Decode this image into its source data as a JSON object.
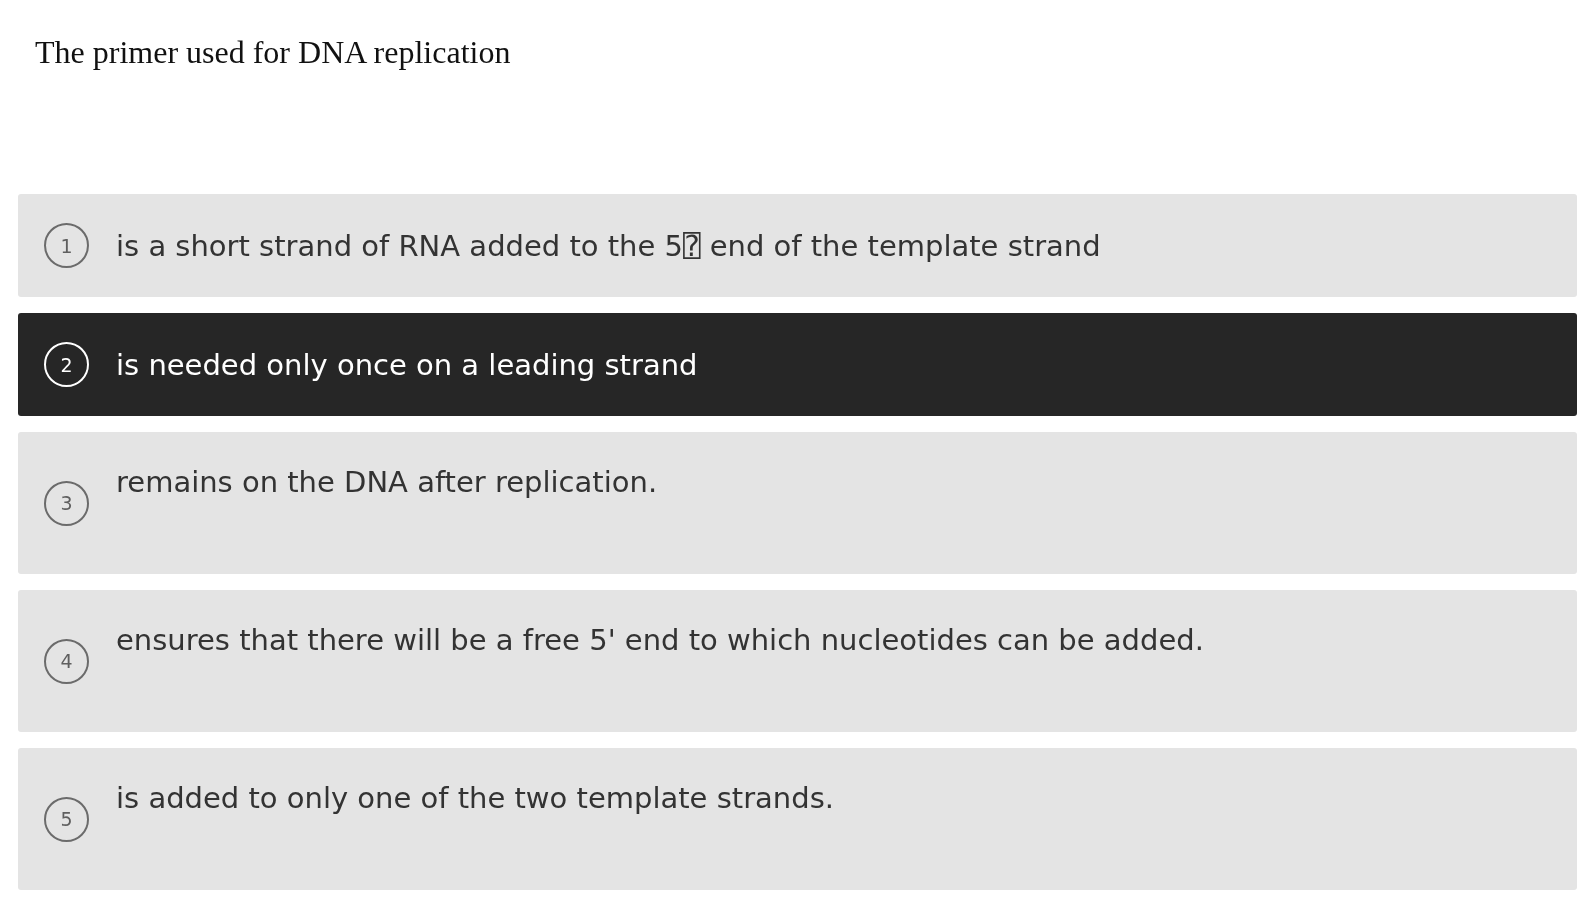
{
  "question": {
    "text": "The primer used for DNA replication"
  },
  "options": [
    {
      "number": "1",
      "text": "is a short strand of RNA added to the 5⍰ end of the template strand",
      "kind": "compact",
      "selected": false
    },
    {
      "number": "2",
      "text": "is needed only once on a leading strand",
      "kind": "compact",
      "selected": true
    },
    {
      "number": "3",
      "text": "remains on the DNA after replication.",
      "kind": "spaced",
      "selected": false
    },
    {
      "number": "4",
      "text": "ensures that there will be a free 5' end to which nucleotides can be added.",
      "kind": "spaced",
      "selected": false
    },
    {
      "number": "5",
      "text": "is added to only one of the two template strands.",
      "kind": "spaced",
      "selected": false
    }
  ]
}
